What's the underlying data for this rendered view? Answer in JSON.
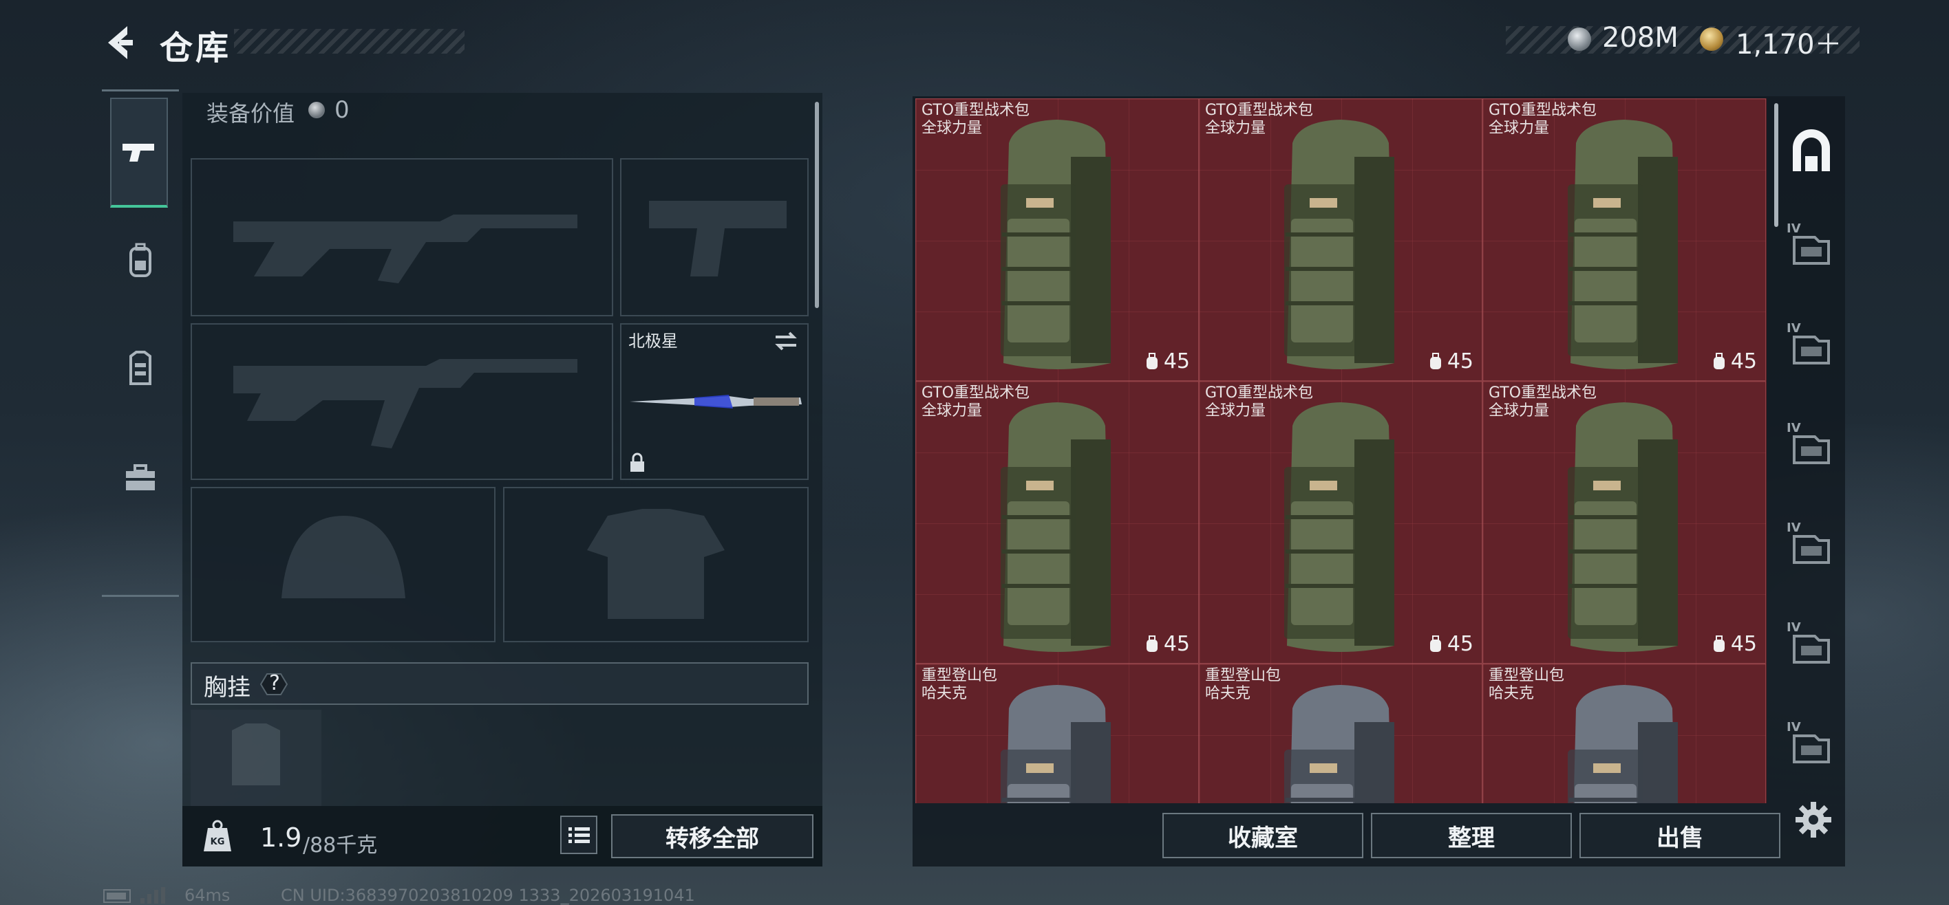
{
  "header": {
    "title": "仓库",
    "silver_amount": "208M",
    "gold_amount": "1,170＋"
  },
  "nav": {
    "items": [
      {
        "name": "weapon",
        "active": true
      },
      {
        "name": "backpack",
        "active": false
      },
      {
        "name": "vest",
        "active": false
      },
      {
        "name": "toolbox",
        "active": false
      }
    ]
  },
  "loadout": {
    "equip_value_label": "装备价值",
    "equip_value": "0",
    "melee_name": "北极星",
    "chest_label": "胸挂",
    "chest_help": "?",
    "weight_current": "1.9",
    "weight_max": "/88千克",
    "transfer_all": "转移全部"
  },
  "storage": {
    "items": [
      {
        "line1": "GTO重型战术包",
        "line2": "全球力量",
        "capacity": "45",
        "color": "olive"
      },
      {
        "line1": "GTO重型战术包",
        "line2": "全球力量",
        "capacity": "45",
        "color": "olive"
      },
      {
        "line1": "GTO重型战术包",
        "line2": "全球力量",
        "capacity": "45",
        "color": "olive"
      },
      {
        "line1": "GTO重型战术包",
        "line2": "全球力量",
        "capacity": "45",
        "color": "olive"
      },
      {
        "line1": "GTO重型战术包",
        "line2": "全球力量",
        "capacity": "45",
        "color": "olive"
      },
      {
        "line1": "GTO重型战术包",
        "line2": "全球力量",
        "capacity": "45",
        "color": "olive"
      },
      {
        "line1": "重型登山包",
        "line2": "哈夫克",
        "capacity": "",
        "color": "gray"
      },
      {
        "line1": "重型登山包",
        "line2": "哈夫克",
        "capacity": "",
        "color": "gray"
      },
      {
        "line1": "重型登山包",
        "line2": "哈夫克",
        "capacity": "",
        "color": "gray"
      }
    ],
    "actions": {
      "collection": "收藏室",
      "organize": "整理",
      "sell": "出售"
    }
  },
  "tabs": [
    {
      "label": "",
      "icon": "storage-home-icon",
      "active": true
    },
    {
      "label": "IV",
      "icon": "storage-tab-icon"
    },
    {
      "label": "IV",
      "icon": "storage-tab-icon"
    },
    {
      "label": "IV",
      "icon": "storage-tab-icon"
    },
    {
      "label": "IV",
      "icon": "storage-tab-icon"
    },
    {
      "label": "IV",
      "icon": "storage-tab-icon"
    },
    {
      "label": "IV",
      "icon": "storage-tab-icon"
    }
  ],
  "footer": {
    "ping": "64ms",
    "uid": "CN UID:3683970203810209 1333_202603191041"
  },
  "colors": {
    "accent_green": "#44c59a",
    "storage_red": "#622229"
  }
}
